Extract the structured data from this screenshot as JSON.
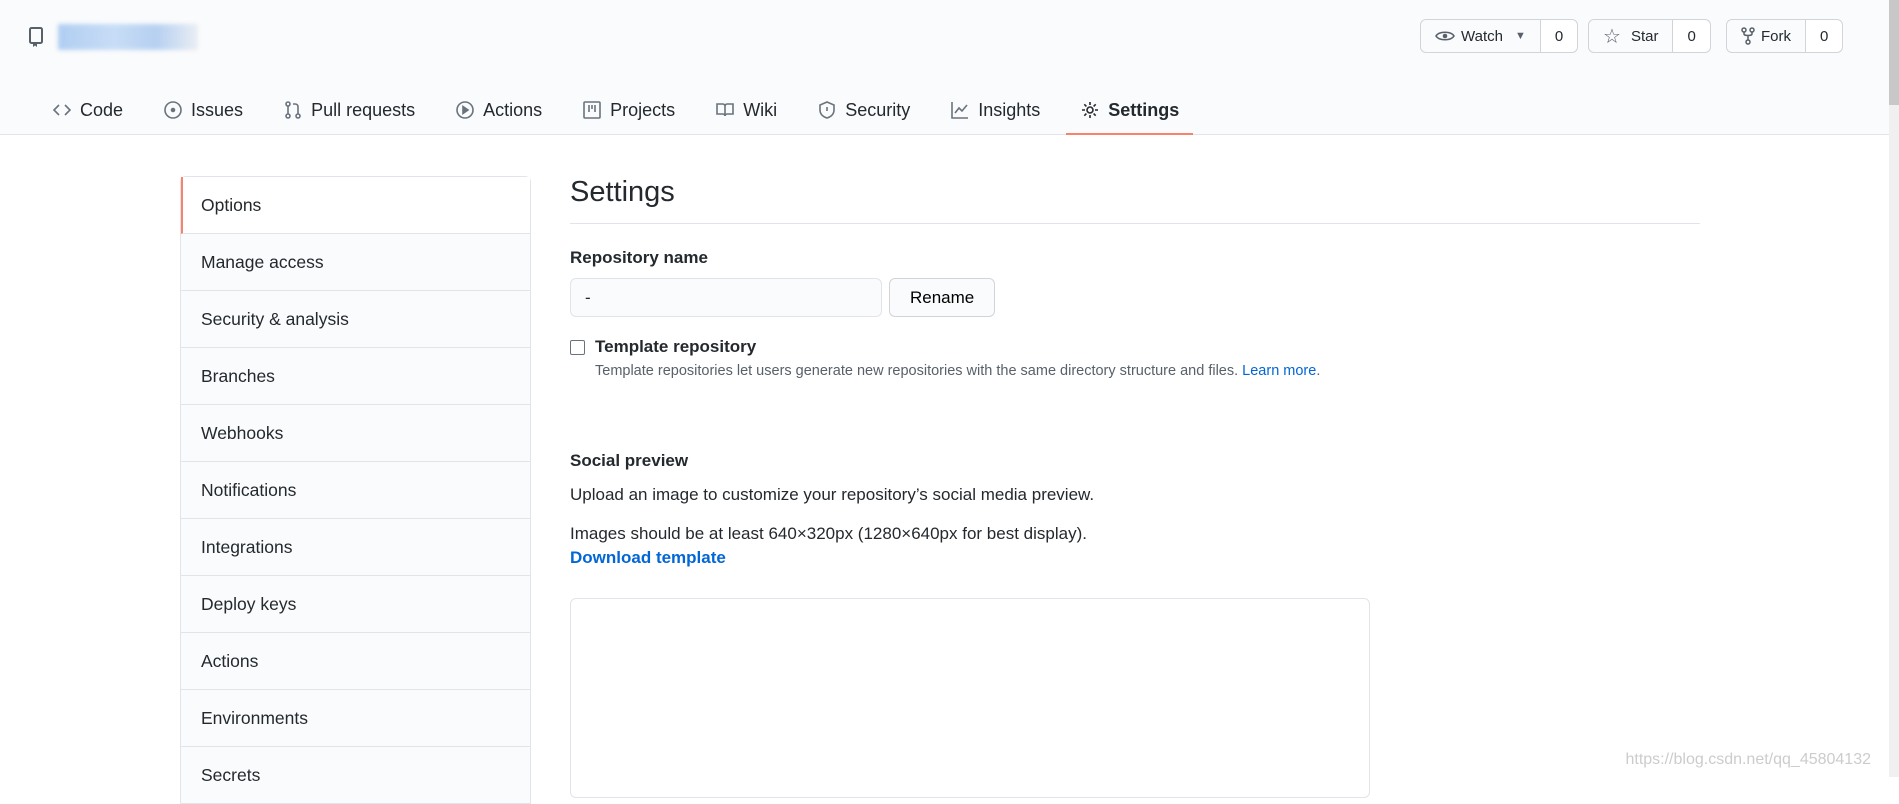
{
  "repo": {
    "name": "",
    "icon": "repo-icon"
  },
  "buttons": [
    {
      "label": "Watch",
      "count": "0",
      "icon": "eye-icon"
    },
    {
      "label": "Star",
      "count": "0",
      "icon": "star-icon"
    },
    {
      "label": "Fork",
      "count": "0",
      "icon": "fork-icon"
    }
  ],
  "tabs": [
    {
      "label": "Code"
    },
    {
      "label": "Issues"
    },
    {
      "label": "Pull requests"
    },
    {
      "label": "Actions"
    },
    {
      "label": "Projects"
    },
    {
      "label": "Wiki"
    },
    {
      "label": "Security"
    },
    {
      "label": "Insights"
    },
    {
      "label": "Settings",
      "selected": true
    }
  ],
  "sidebar": {
    "items": [
      "Options",
      "Manage access",
      "Security & analysis",
      "Branches",
      "Webhooks",
      "Notifications",
      "Integrations",
      "Deploy keys",
      "Actions",
      "Environments",
      "Secrets"
    ]
  },
  "main": {
    "title": "Settings",
    "repo_name_label": "Repository name",
    "repo_name_value": "-",
    "rename": "Rename",
    "template_label": "Template repository",
    "template_note": "Template repositories let users generate new repositories with the same directory structure and files.",
    "learn_more": "Learn more",
    "social_title": "Social preview",
    "social_p1": "Upload an image to customize your repository’s social media preview.",
    "social_p2": "Images should be at least 640×320px (1280×640px for best display).",
    "download": "Download template"
  },
  "watermark": "https://blog.csdn.net/qq_45804132",
  "colors": {
    "accent": "#f9826c",
    "link": "#0366d6"
  }
}
